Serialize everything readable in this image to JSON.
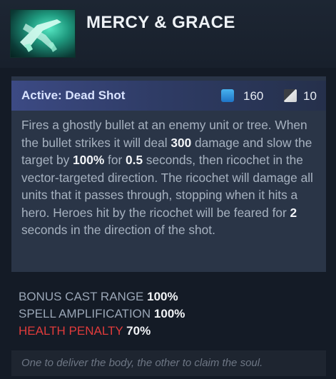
{
  "item": {
    "title": "MERCY & GRACE",
    "icon": "dual-pistols-icon"
  },
  "ability": {
    "name": "Active: Dead Shot",
    "mana_cost": "160",
    "cooldown": "10",
    "mana_icon": "mana-icon",
    "cooldown_icon": "cooldown-icon",
    "description": {
      "p1": "Fires a ghostly bullet at an enemy unit or tree. When the bullet strikes it will deal ",
      "damage": "300",
      "p2": " damage and slow the target by ",
      "slow": "100%",
      "p3": " for ",
      "duration": "0.5",
      "p4": " seconds, then ricochet in the vector-targeted direction. The ricochet will damage all units that it passes through, stopping when it hits a hero. Heroes hit by the ricochet will be feared for ",
      "fear": "2",
      "p5": " seconds in the direction of the shot."
    }
  },
  "attributes": [
    {
      "label": "BONUS CAST RANGE",
      "value": "100%"
    },
    {
      "label": "SPELL AMPLIFICATION",
      "value": "100%"
    },
    {
      "label": "HEALTH PENALTY",
      "value": "70%"
    }
  ],
  "lore": "One to deliver the body, the other to claim the soul.",
  "colors": {
    "background": "#141b26",
    "ability_header": "#3c4a84",
    "penalty": "#e03b3b",
    "mana": "#2f8fe0"
  }
}
